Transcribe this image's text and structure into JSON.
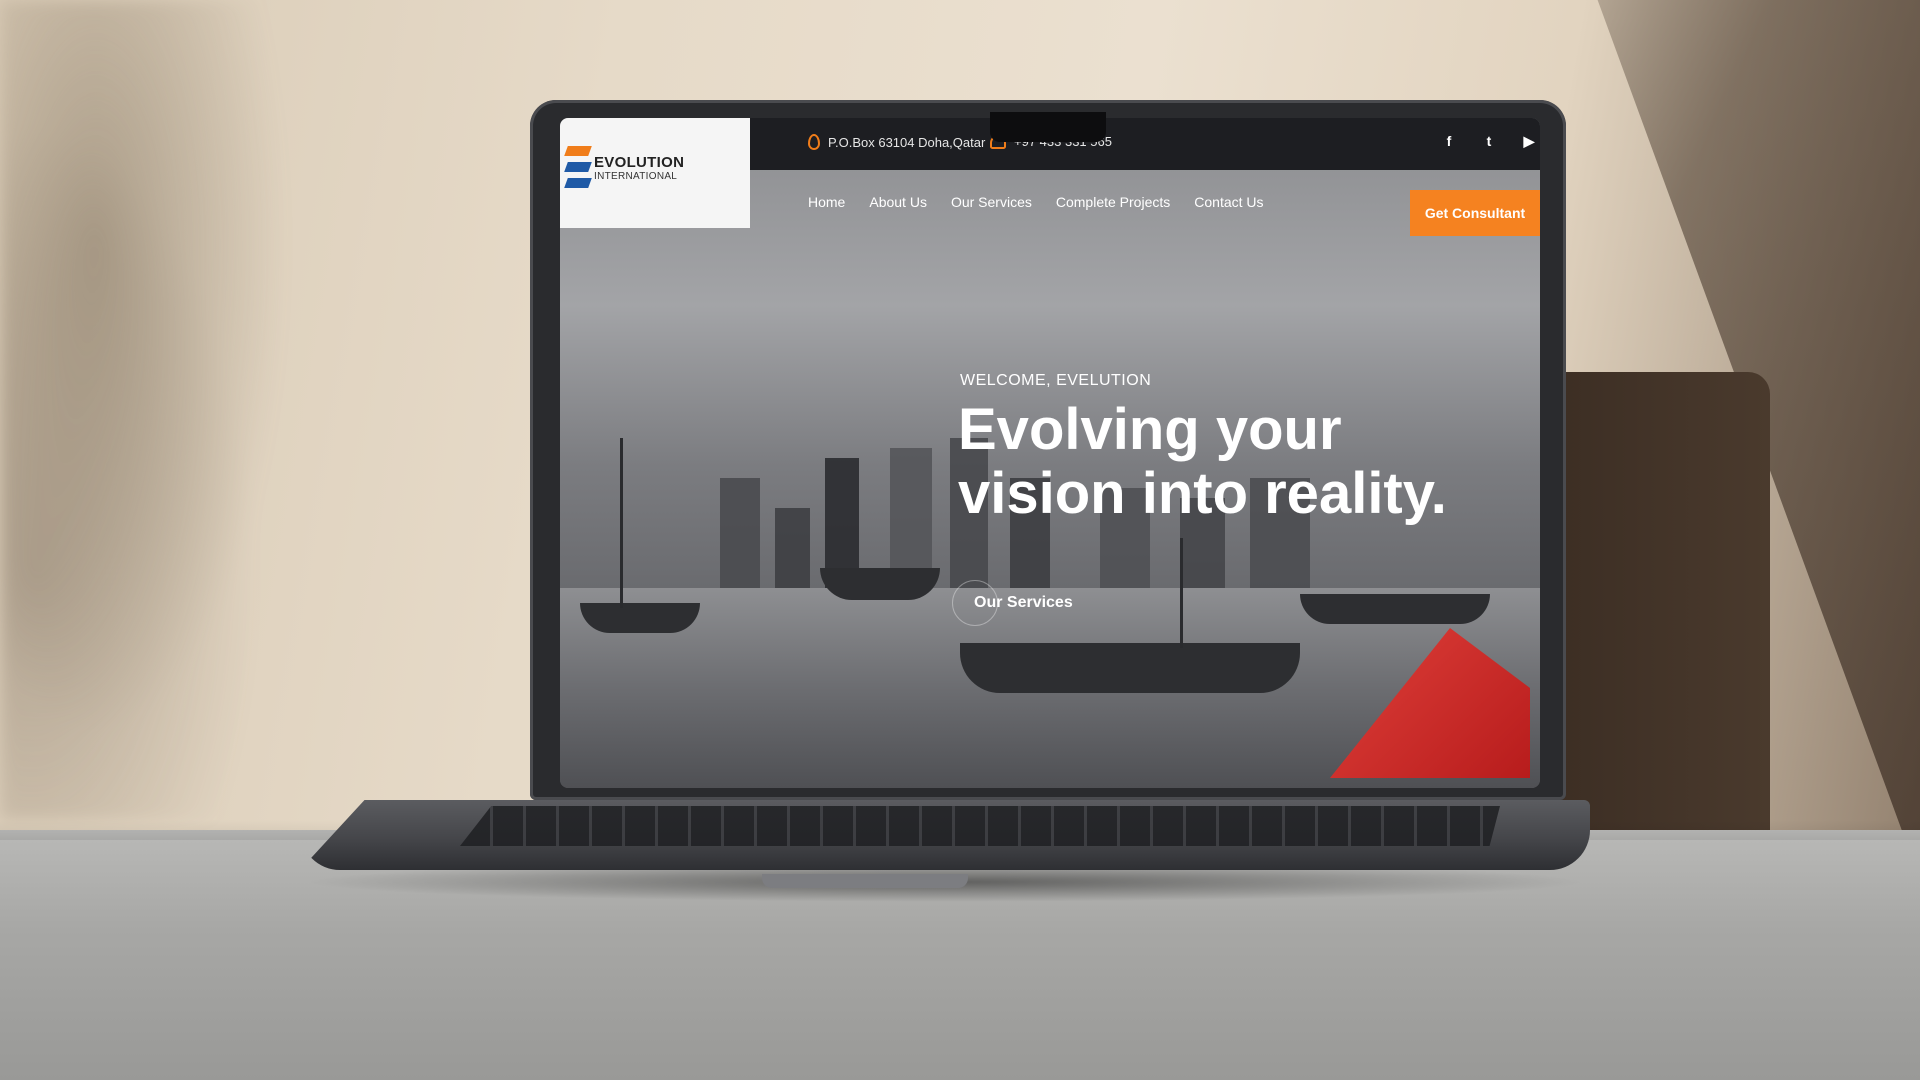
{
  "site": {
    "logo": {
      "title": "EVOLUTION",
      "subtitle": "INTERNATIONAL"
    },
    "contact": {
      "address": "P.O.Box 63104 Doha,Qatar",
      "phone": "+97 433 331 565"
    },
    "social": [
      {
        "name": "facebook-icon",
        "glyph": "f"
      },
      {
        "name": "twitter-icon",
        "glyph": "t"
      },
      {
        "name": "youtube-icon",
        "glyph": "▶"
      }
    ],
    "nav": [
      "Home",
      "About Us",
      "Our Services",
      "Complete Projects",
      "Contact Us"
    ],
    "cta": "Get Consultant",
    "hero": {
      "welcome": "WELCOME, EVELUTION",
      "headline": "Evolving your vision into reality.",
      "button": "Our Services"
    },
    "colors": {
      "accent": "#f58220",
      "topbar": "#1d1e22",
      "logo_orange": "#f07d1a",
      "logo_blue": "#1f5aa6"
    }
  }
}
